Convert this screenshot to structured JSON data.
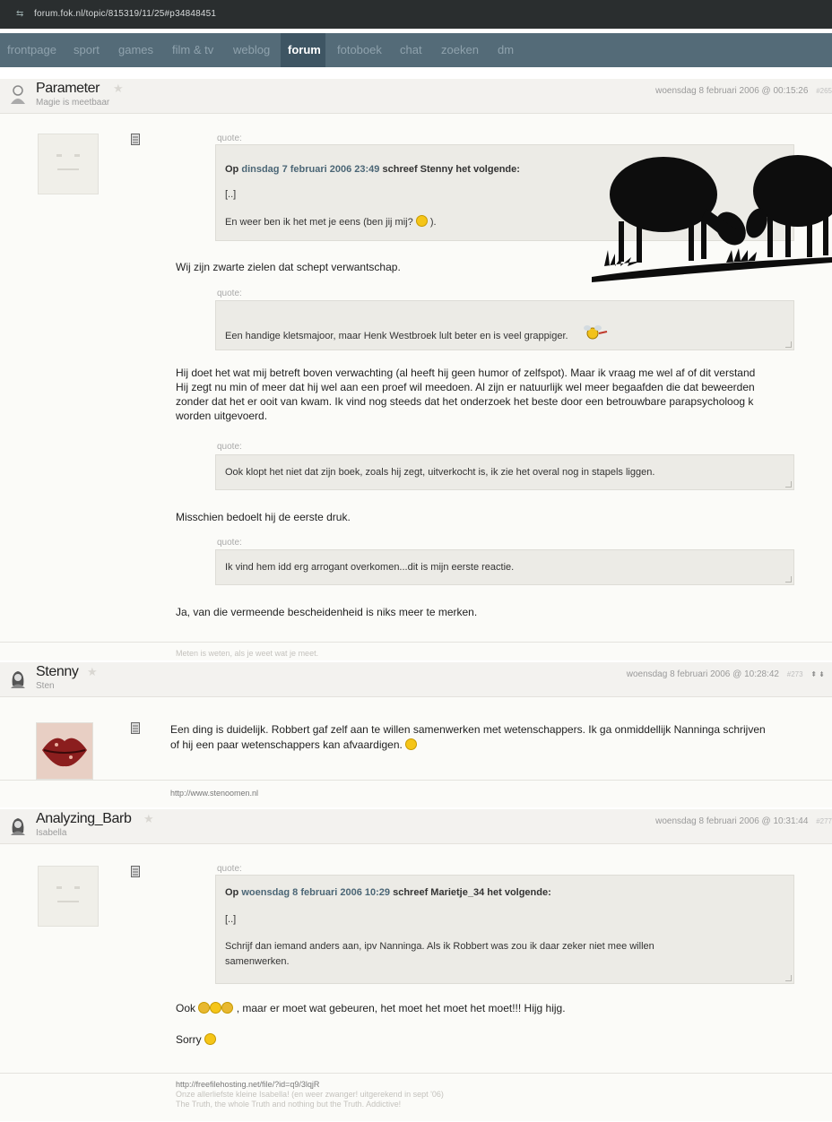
{
  "browser": {
    "url": "forum.fok.nl/topic/815319/11/25#p34848451"
  },
  "nav": {
    "items": [
      "frontpage",
      "sport",
      "games",
      "film & tv",
      "weblog",
      "forum",
      "fotoboek",
      "chat",
      "zoeken",
      "dm"
    ],
    "active": "forum"
  },
  "posts": [
    {
      "username": "Parameter",
      "tagline": "Magie is meetbaar",
      "date": "woensdag 8 februari 2006 @ 00:15:",
      "seconds": "26",
      "postno": "#265",
      "quote_label": "quote:",
      "quote1": {
        "prefix": "Op",
        "date": "dinsdag 7 februari 2006 23:49",
        "suffix": "schreef Stenny het volgende:",
        "ellipsis": "[..]",
        "text_before": "En weer ben ik het met je eens (ben jij mij?",
        "text_after": ")."
      },
      "line1": "Wij zijn zwarte zielen dat schept verwantschap.",
      "quote2": "Een handige kletsmajoor, maar Henk Westbroek lult beter en is veel grappiger.",
      "para_lines": [
        "Hij doet het wat mij betreft boven verwachting (al heeft hij geen humor of zelfspot). Maar ik vraag me wel af of dit verstand",
        "Hij zegt nu min of meer dat hij wel aan een proef wil meedoen. Al zijn er natuurlijk wel meer begaafden die dat beweerden",
        "zonder dat het er ooit van kwam. Ik vind nog steeds dat het onderzoek het beste door een betrouwbare parapsycholoog k",
        "worden uitgevoerd."
      ],
      "quote3": "Ook klopt het niet dat zijn boek, zoals hij zegt, uitverkocht is, ik zie het overal nog in stapels liggen.",
      "line2": "Misschien bedoelt hij de eerste druk.",
      "quote4": "Ik vind hem idd erg arrogant overkomen...dit is mijn eerste reactie.",
      "line3": "Ja, van die vermeende bescheidenheid is niks meer te merken.",
      "signature": "Meten is weten, als je weet wat je meet."
    },
    {
      "username": "Stenny",
      "tagline": "Sten",
      "date": "woensdag 8 februari 2006 @ 10:28:",
      "seconds": "42",
      "postno": "#273",
      "arrows": "⇞ ⇟",
      "body_lines": [
        "Een ding is duidelijk. Robbert gaf zelf aan te willen samenwerken met wetenschappers. Ik ga onmiddellijk Nanninga schrijven",
        "of hij een paar wetenschappers kan afvaardigen."
      ],
      "signature": "http://www.stenoomen.nl"
    },
    {
      "username": "Analyzing_Barb",
      "tagline": "Isabella",
      "date": "woensdag 8 februari 2006 @ 10:31:",
      "seconds": "44",
      "postno": "#277",
      "quote_label": "quote:",
      "quote1": {
        "prefix": "Op",
        "date": "woensdag 8 februari 2006 10:29",
        "suffix": "schreef Marietje_34 het volgende:",
        "ellipsis": "[..]",
        "text_lines": [
          "Schrijf dan iemand anders aan, ipv Nanninga. Als ik Robbert was zou ik daar zeker niet mee willen",
          "samenwerken."
        ]
      },
      "line1_before": "Ook",
      "line1_after": ", maar er moet wat gebeuren, het moet het moet het moet!!! Hijg hijg.",
      "line2": "Sorry",
      "signature_lines": [
        "http://freefilehosting.net/file/?id=q9/3lqjR",
        "Onze allerliefste kleine Isabella! (en weer zwanger! uitgerekend in sept '06)",
        "The Truth, the whole Truth and nothing but the Truth. Addictive!"
      ]
    }
  ],
  "colors": {
    "nav": "#546b78",
    "nav_active": "#3e5563",
    "urlbar": "#2a2e2f",
    "quote_bg": "#ecebe6",
    "post_bg": "#fbfbf8"
  },
  "icons": [
    "lock-icon",
    "user-icon",
    "star-icon",
    "page-icon",
    "smiley-icon",
    "sheep-image",
    "bee-smiley-icon"
  ]
}
